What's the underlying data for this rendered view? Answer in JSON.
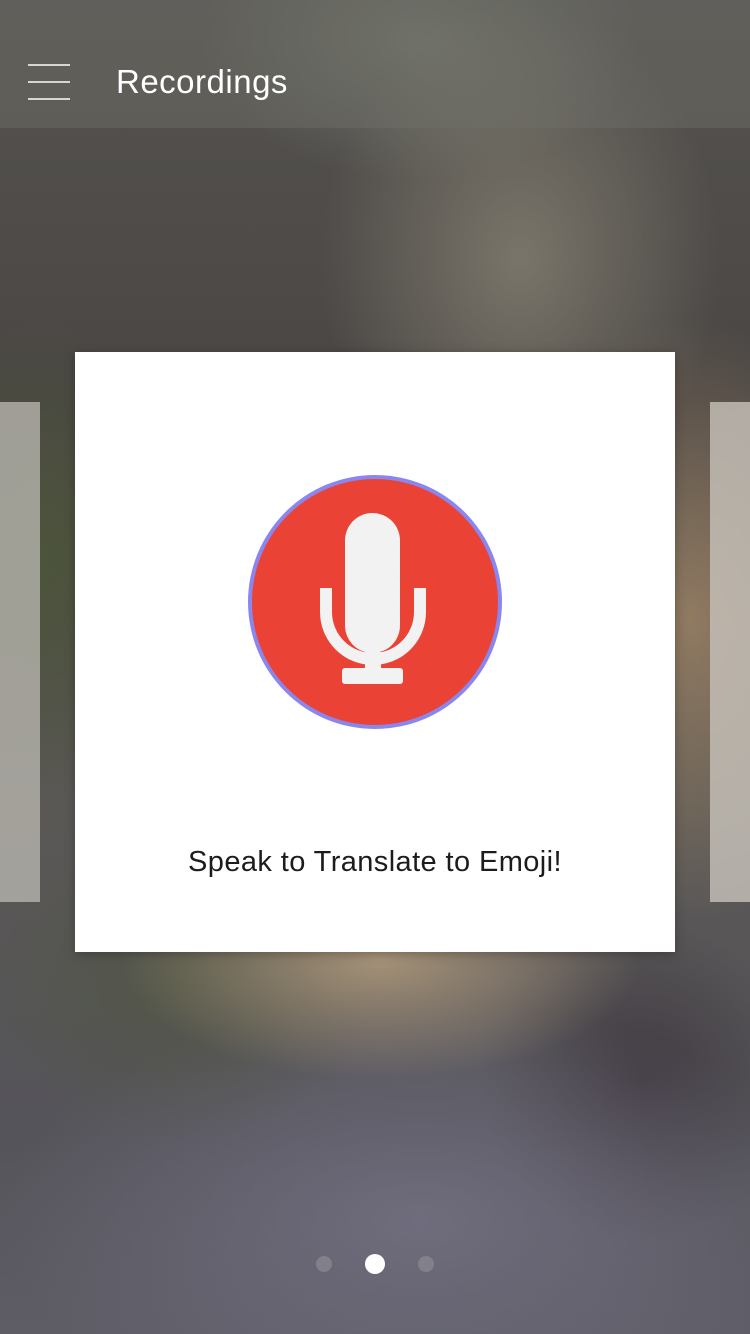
{
  "header": {
    "title": "Recordings",
    "menu_icon": "hamburger-menu-icon"
  },
  "card": {
    "mic_icon": "microphone-icon",
    "caption": "Speak to Translate to Emoji!"
  },
  "colors": {
    "mic_fill": "#EA4335",
    "mic_ring": "#8A86F0",
    "mic_glyph": "#F2F2F2",
    "card_background": "#FFFFFF"
  },
  "pager": {
    "page_count": 3,
    "current_page": 2
  }
}
